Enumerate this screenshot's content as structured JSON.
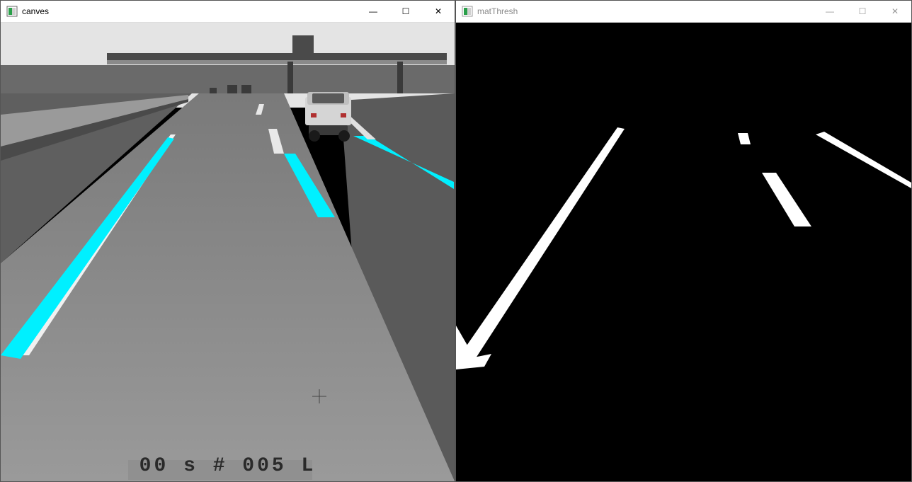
{
  "windows": {
    "left": {
      "title": "canves",
      "active": true,
      "overlay_text": "00 s # 005 L"
    },
    "right": {
      "title": "matThresh",
      "active": false
    }
  },
  "controls": {
    "minimize_glyph": "—",
    "maximize_glyph": "☐",
    "close_glyph": "✕"
  },
  "colors": {
    "lane_highlight": "#00f0ff",
    "road_gray": "#808080",
    "sky_gray": "#e0e0e0",
    "thresh_bg": "#000000",
    "thresh_fg": "#ffffff"
  }
}
